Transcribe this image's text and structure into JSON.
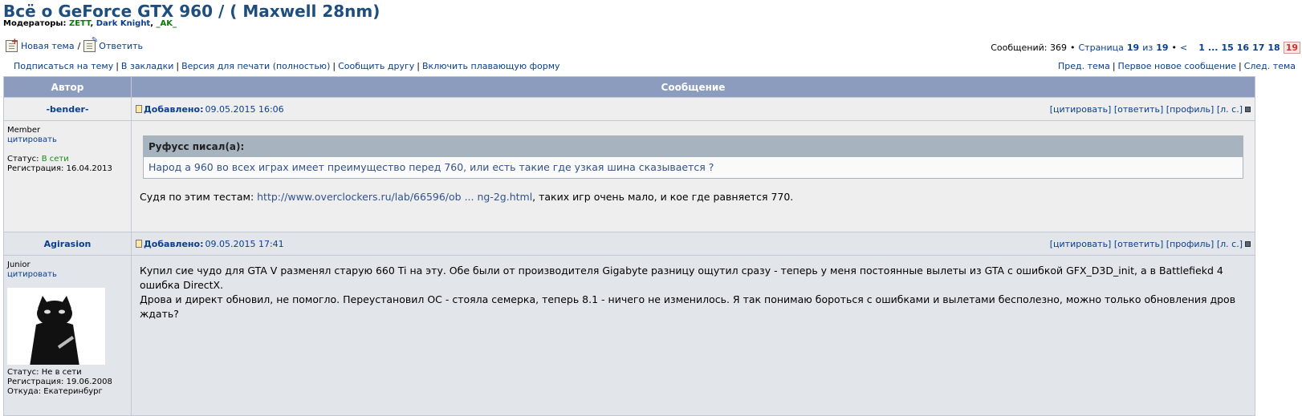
{
  "topic": {
    "title": "Всё о GeForce GTX 960 / ( Maxwell 28nm)",
    "moderators_label": "Модераторы:",
    "moderators": [
      "ZETT",
      "Dark Knight",
      "_AK_"
    ]
  },
  "toolbar": {
    "new_topic": "Новая тема",
    "reply": "Ответить"
  },
  "pager": {
    "messages_label": "Сообщений: 369",
    "page_label": "Страница",
    "page_current": "19",
    "of": "из",
    "page_total": "19",
    "prev": "<",
    "pages": [
      "1",
      "...",
      "15",
      "16",
      "17",
      "18"
    ],
    "current": "19"
  },
  "links": {
    "subscribe": "Подписаться на тему",
    "bookmarks": "В закладки",
    "print": "Версия для печати (полностью)",
    "tell_friend": "Сообщить другу",
    "floating_form": "Включить плавающую форму",
    "prev_topic": "Пред. тема",
    "first_new": "Первое новое сообщение",
    "next_topic": "След. тема"
  },
  "table": {
    "col_author": "Автор",
    "col_message": "Сообщение"
  },
  "actions": {
    "quote": "[цитировать]",
    "reply": "[ответить]",
    "profile": "[профиль]",
    "pm": "[л. с.]"
  },
  "posts": [
    {
      "author": "-bender-",
      "added_label": "Добавлено:",
      "date": "09.05.2015 16:06",
      "rank": "Member",
      "quote_link": "цитировать",
      "status_label": "Статус:",
      "status": "В сети",
      "reg": "Регистрация: 16.04.2013",
      "quote_head": "Руфусс писал(а):",
      "quote_text": "Народ а 960 во всех играх имеет преимущество перед 760, или есть такие где узкая шина сказывается ?",
      "text_before": "Судя по этим тестам: ",
      "link": "http://www.overclockers.ru/lab/66596/ob ... ng-2g.html",
      "text_after": ", таких игр очень мало, и кое где равняется 770."
    },
    {
      "author": "Agirasion",
      "added_label": "Добавлено:",
      "date": "09.05.2015 17:41",
      "rank": "Junior",
      "quote_link": "цитировать",
      "status": "Статус: Не в сети",
      "reg": "Регистрация: 19.06.2008",
      "from": "Откуда: Екатеринбург",
      "text1": "Купил сие чудо для GTA V разменял старую 660 Ti на эту. Обе были от производителя Gigabyte разницу ощутил сразу - теперь у меня постоянные вылеты из GTA с ошибкой GFX_D3D_init, а в Battlefiekd 4 ошибка DirectX.",
      "text2": "Дрова и директ обновил, не помогло. Переустановил ОС - стояла семерка, теперь 8.1 - ничего не изменилось. Я так понимаю бороться с ошибками и вылетами бесполезно, можно только обновления дров ждать?"
    }
  ]
}
